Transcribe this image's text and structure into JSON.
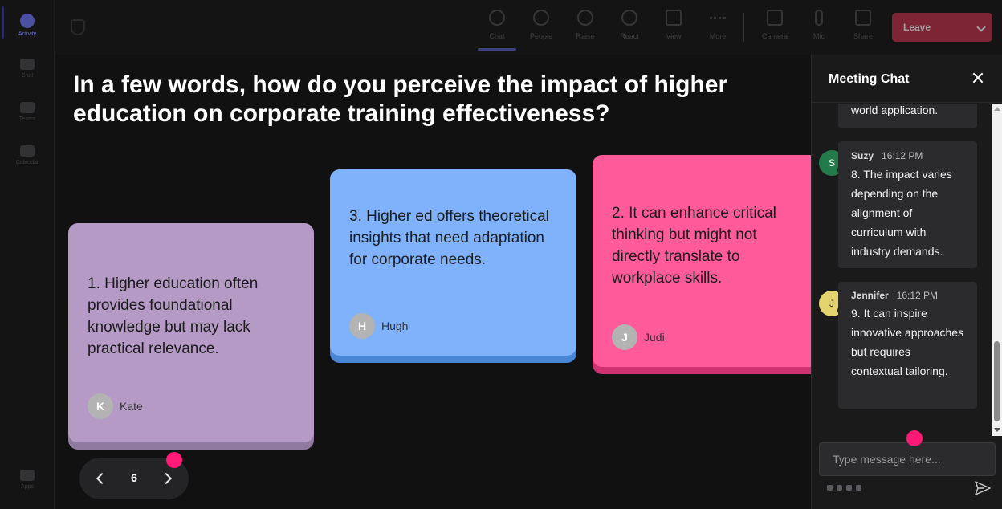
{
  "toolbar": {
    "items": [
      {
        "label": "Chat",
        "icon": "chat-icon"
      },
      {
        "label": "People",
        "icon": "people-icon"
      },
      {
        "label": "Raise",
        "icon": "hand-icon"
      },
      {
        "label": "React",
        "icon": "smile-icon"
      },
      {
        "label": "View",
        "icon": "grid-icon"
      },
      {
        "label": "More",
        "icon": "more-icon"
      },
      {
        "label": "Camera",
        "icon": "camera-icon"
      },
      {
        "label": "Mic",
        "icon": "mic-icon"
      },
      {
        "label": "Share",
        "icon": "share-icon"
      }
    ],
    "leave_label": "Leave"
  },
  "rail": {
    "items": [
      {
        "label": "Activity",
        "icon": "bell-icon"
      },
      {
        "label": "Chat",
        "icon": "chat-icon"
      },
      {
        "label": "Teams",
        "icon": "teams-icon"
      },
      {
        "label": "Calendar",
        "icon": "calendar-icon"
      },
      {
        "label": "Apps",
        "icon": "apps-icon"
      }
    ]
  },
  "stage": {
    "question": "In a few words, how do you perceive the impact of higher education on corporate training effectiveness?",
    "cards": [
      {
        "text": "1. Higher education often provides foundational knowledge but may lack practical relevance.",
        "initial": "K",
        "author": "Kate",
        "color": "#b59ac5"
      },
      {
        "text": "3. Higher ed offers theoretical insights that need adaptation for corporate needs.",
        "initial": "H",
        "author": "Hugh",
        "color": "#7fb2fb"
      },
      {
        "text": "2. It can enhance critical thinking but might not directly translate to workplace skills.",
        "initial": "J",
        "author": "Judi",
        "color": "#ff5a99"
      }
    ],
    "pager": {
      "page": "6"
    }
  },
  "chat": {
    "title": "Meeting Chat",
    "messages": [
      {
        "body": "world application."
      },
      {
        "initial": "S",
        "name": "Suzy",
        "time": "16:12 PM",
        "body": "8. The impact varies depending on the alignment of curriculum with industry demands.",
        "avatar_color": "#237b4b"
      },
      {
        "initial": "J",
        "name": "Jennifer",
        "time": "16:12 PM",
        "body": "9. It can inspire innovative approaches but requires contextual tailoring.",
        "avatar_color": "#e3d36e"
      }
    ],
    "input_placeholder": "Type message here..."
  },
  "colors": {
    "accent": "#5b5fc7",
    "highlight_dot": "#ff1a75",
    "leave": "#c4314b"
  }
}
